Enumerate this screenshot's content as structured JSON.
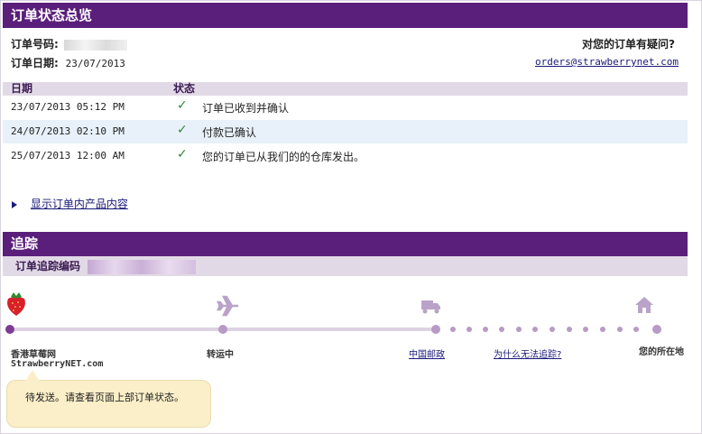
{
  "summary": {
    "title": "订单状态总览",
    "order_no_label": "订单号码:",
    "order_date_label": "订单日期:",
    "order_date": "23/07/2013",
    "question": "对您的订单有疑问?",
    "email": "orders@strawberrynet.com"
  },
  "status_table": {
    "headers": [
      "日期",
      "状态"
    ],
    "rows": [
      {
        "date": "23/07/2013 05:12 PM",
        "status": "订单已收到并确认"
      },
      {
        "date": "24/07/2013 02:10 PM",
        "status": "付款已确认"
      },
      {
        "date": "25/07/2013 12:00 AM",
        "status": "您的订单已从我们的的仓库发出。"
      }
    ],
    "check_glyph": "✓"
  },
  "show_contents_link": "显示订单内产品内容",
  "tracking": {
    "title": "追踪",
    "code_label": "订单追踪编码",
    "stage1_name": "香港草莓网",
    "stage1_sub": "StrawberryNET.com",
    "stage2": "转运中",
    "stage3": "中国邮政",
    "why_link": "为什么无法追踪?",
    "stage4": "您的所在地",
    "bubble": "待发送。请查看页面上部订单状态。"
  },
  "icons": {
    "strawberry": "strawberry-icon",
    "plane": "plane-icon",
    "truck": "truck-icon",
    "house": "house-icon",
    "arrow": "triangle-right-icon"
  },
  "colors": {
    "header_purple": "#5a1f7a",
    "sub_lavender": "#e2d9e6",
    "row_highlight": "#e8f1f9",
    "check_green": "#2e8b3a",
    "bubble_yellow": "#fbefc9"
  }
}
